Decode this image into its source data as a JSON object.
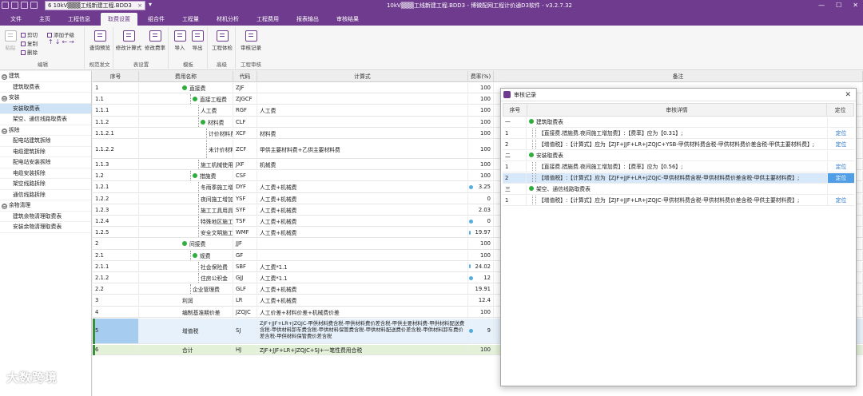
{
  "titlebar": {
    "doc_tab": "6 10kV▒▒▒工线新建工程.BDD3",
    "title": "10kV▒▒▒工线新建工程.BDD3 - 博微配网工程计价通D3软件 - v3.2.7.32"
  },
  "menu": [
    "文件",
    "主页",
    "工程信息",
    "取费设置",
    "组合件",
    "工程量",
    "材机分析",
    "工程费用",
    "报表输出",
    "审核结果"
  ],
  "menu_active": 3,
  "ribbon": {
    "clip": {
      "cut": "剪切",
      "copy": "复制",
      "delete": "删除",
      "paste": "粘贴",
      "add_child": "添加子级",
      "group": "编辑"
    },
    "g2": {
      "label": "查询预览",
      "group": "规范文",
      "group_full": "规范发文"
    },
    "g3": {
      "b1": "修改计算式",
      "b2": "修改费率",
      "group": "表设置"
    },
    "g4": {
      "b1": "导入",
      "b2": "导出",
      "group": "模板"
    },
    "g5": {
      "b1": "工程体检",
      "group": "高级"
    },
    "g6": {
      "b1": "审核记录",
      "group": "工程审核"
    }
  },
  "tree": [
    {
      "label": "建筑",
      "level": 0,
      "toggle": "⊖"
    },
    {
      "label": "建筑取费表",
      "level": 1
    },
    {
      "label": "安装",
      "level": 0,
      "toggle": "⊖"
    },
    {
      "label": "安装取费表",
      "level": 1,
      "selected": true
    },
    {
      "label": "架空、通信线路取费表",
      "level": 1
    },
    {
      "label": "拆除",
      "level": 0,
      "toggle": "⊖"
    },
    {
      "label": "配电站建筑拆除",
      "level": 1
    },
    {
      "label": "电缆建筑拆除",
      "level": 1
    },
    {
      "label": "配电站安装拆除",
      "level": 1
    },
    {
      "label": "电缆安装拆除",
      "level": 1
    },
    {
      "label": "架空线路拆除",
      "level": 1
    },
    {
      "label": "通信线路拆除",
      "level": 1
    },
    {
      "label": "余物清理",
      "level": 0,
      "toggle": "⊖"
    },
    {
      "label": "建筑余物清理取费表",
      "level": 1
    },
    {
      "label": "安装余物清理取费表",
      "level": 1
    }
  ],
  "grid": {
    "headers": [
      "序号",
      "费用名称",
      "代码",
      "计算式",
      "费率(%)",
      "备注"
    ],
    "rows": [
      {
        "no": "1",
        "name": "直接费",
        "indent": 0,
        "dot": true,
        "code": "ZJF",
        "formula": "",
        "rate": "100"
      },
      {
        "no": "1.1",
        "name": "直接工程费",
        "indent": 1,
        "dot": true,
        "code": "ZJGCF",
        "formula": "",
        "rate": "100"
      },
      {
        "no": "1.1.1",
        "name": "人工费",
        "indent": 2,
        "code": "RGF",
        "formula": "人工费",
        "rate": "100"
      },
      {
        "no": "1.1.2",
        "name": "材料费",
        "indent": 2,
        "dot": true,
        "code": "CLF",
        "formula": "",
        "rate": "100"
      },
      {
        "no": "1.1.2.1",
        "name": "计价材料费",
        "indent": 3,
        "code": "XCF",
        "formula": "材料费",
        "rate": "100"
      },
      {
        "no": "1.1.2.2",
        "name": "未计价材料费",
        "indent": 3,
        "code": "ZCF",
        "formula": "甲供主要材料费+乙供主要材料费",
        "rate": "100",
        "tall": true
      },
      {
        "no": "1.1.3",
        "name": "施工机械使用费",
        "indent": 2,
        "code": "JXF",
        "formula": "机械费",
        "rate": "100"
      },
      {
        "no": "1.2",
        "name": "措施费",
        "indent": 1,
        "dot": true,
        "code": "CSF",
        "formula": "",
        "rate": "100"
      },
      {
        "no": "1.2.1",
        "name": "冬雨季施工增加费",
        "indent": 2,
        "code": "DYF",
        "formula": "人工费+机械费",
        "rate": "3.25",
        "blue": true
      },
      {
        "no": "1.2.2",
        "name": "夜间施工增加费",
        "indent": 2,
        "code": "YSF",
        "formula": "人工费+机械费",
        "rate": "0"
      },
      {
        "no": "1.2.3",
        "name": "施工工具用具使用费",
        "indent": 2,
        "code": "SYF",
        "formula": "人工费+机械费",
        "rate": "2.03"
      },
      {
        "no": "1.2.4",
        "name": "特殊地区施工增加费",
        "indent": 2,
        "code": "TSF",
        "formula": "人工费+机械费",
        "rate": "0",
        "blue": true
      },
      {
        "no": "1.2.5",
        "name": "安全文明施工费",
        "indent": 2,
        "code": "WMF",
        "formula": "人工费+机械费",
        "rate": "19.97",
        "blue": true
      },
      {
        "no": "2",
        "name": "间接费",
        "indent": 0,
        "dot": true,
        "code": "JJF",
        "formula": "",
        "rate": "100"
      },
      {
        "no": "2.1",
        "name": "规费",
        "indent": 1,
        "dot": true,
        "code": "GF",
        "formula": "",
        "rate": "100"
      },
      {
        "no": "2.1.1",
        "name": "社会保险费",
        "indent": 2,
        "code": "SBF",
        "formula": "人工费*1.1",
        "rate": "24.02",
        "blue": true
      },
      {
        "no": "2.1.2",
        "name": "住房公积金",
        "indent": 2,
        "code": "GJJ",
        "formula": "人工费*1.1",
        "rate": "12",
        "blue": true
      },
      {
        "no": "2.2",
        "name": "企业管理费",
        "indent": 1,
        "code": "GLF",
        "formula": "人工费+机械费",
        "rate": "19.91"
      },
      {
        "no": "3",
        "name": "利润",
        "indent": 0,
        "code": "LR",
        "formula": "人工费+机械费",
        "rate": "12.4"
      },
      {
        "no": "4",
        "name": "编制基准期价差",
        "indent": 0,
        "code": "JZQJC",
        "formula": "人工价差+材料价差+机械费价差",
        "rate": "100"
      },
      {
        "no": "5",
        "name": "增值税",
        "indent": 0,
        "code": "SJ",
        "formula": "ZJF+JJF+LR+JZQJC-甲供材料费含税-甲供材料费价差含税-甲供主要材料费-甲供材料配送费含税-甲供材料卸车费含税-甲供材料保管费含税-甲供材料配送费价差含税-甲供材料卸车费价差含税-甲供材料保管费价差含税",
        "rate": "9",
        "blue": true,
        "highlight": "blue",
        "wrap": true
      },
      {
        "no": "6",
        "name": "合计",
        "indent": 0,
        "code": "HJ",
        "formula": "ZJF+JJF+LR+JZQJC+SJ+一笔性费用合税",
        "rate": "100",
        "highlight": "green"
      }
    ]
  },
  "dialog": {
    "title": "审核记录",
    "headers": [
      "序号",
      "审核详情",
      "定位"
    ],
    "rows": [
      {
        "no": "一",
        "detail": "建筑取费表",
        "group": true
      },
      {
        "no": "1",
        "detail": "【直接费.措施费.夜间施工增加费】:【费率】应为【0.31】;",
        "link": "定位"
      },
      {
        "no": "2",
        "detail": "【增值税】:【计算式】应为【ZJF+JJF+LR+JZQJC+YSB-甲供材料费含税-甲供材料费价差含税-甲供主要材料费】;",
        "link": "定位"
      },
      {
        "no": "二",
        "detail": "安装取费表",
        "group": true
      },
      {
        "no": "1",
        "detail": "【直接费.措施费.夜间施工增加费】:【费率】应为【0.56】;",
        "link": "定位"
      },
      {
        "no": "2",
        "detail": "【增值税】:【计算式】应为【ZJF+JJF+LR+JZQJC-甲供材料费含税-甲供材料费价差含税-甲供主要材料费】;",
        "link": "定位",
        "selected": true
      },
      {
        "no": "三",
        "detail": "架空、通信线路取费表",
        "group": true
      },
      {
        "no": "1",
        "detail": "【增值税】:【计算式】应为【ZJF+JJF+LR+JZQJC-甲供材料费含税-甲供材料费价差含税-甲供主要材料费】;",
        "link": "定位"
      }
    ]
  },
  "watermark": "大数跨境",
  "colors": {
    "brand": "#6f3b8e",
    "selected": "#cfe3f6",
    "green": "#2fae3b",
    "link": "#1f6fc7"
  }
}
